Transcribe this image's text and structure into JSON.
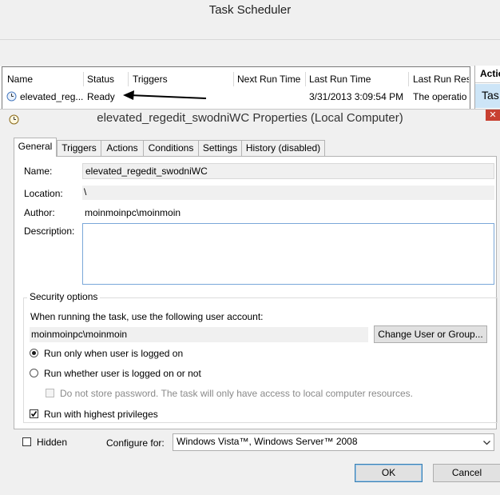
{
  "outer": {
    "title": "Task Scheduler",
    "columns": [
      "Name",
      "Status",
      "Triggers",
      "Next Run Time",
      "Last Run Time",
      "Last Run Resu"
    ],
    "row": {
      "name": "elevated_reg...",
      "status": "Ready",
      "triggers": "",
      "next_run": "",
      "last_run": "3/31/2013 3:09:54 PM",
      "last_result": "The operatio"
    },
    "actions_pane": {
      "header": "Actio",
      "item": "Tas"
    }
  },
  "dialog": {
    "title": "elevated_regedit_swodniWC Properties (Local Computer)",
    "close_glyph": "✕",
    "tabs": [
      "General",
      "Triggers",
      "Actions",
      "Conditions",
      "Settings",
      "History (disabled)"
    ],
    "general": {
      "name_label": "Name:",
      "name_value": "elevated_regedit_swodniWC",
      "location_label": "Location:",
      "location_value": "\\",
      "author_label": "Author:",
      "author_value": "moinmoinpc\\moinmoin",
      "description_label": "Description:",
      "description_value": ""
    },
    "security": {
      "title": "Security options",
      "account_prompt": "When running the task, use the following user account:",
      "account_value": "moinmoinpc\\moinmoin",
      "change_button": "Change User or Group...",
      "radio_logged_on": "Run only when user is logged on",
      "radio_logged_on_selected": true,
      "radio_whether": "Run whether user is logged on or not",
      "no_store_password": "Do not store password.  The task will only have access to local computer resources.",
      "highest_privileges": "Run with highest privileges",
      "highest_privileges_checked": true
    },
    "bottom": {
      "hidden_label": "Hidden",
      "hidden_checked": false,
      "configure_label": "Configure for:",
      "configure_value": "Windows Vista™, Windows Server™ 2008"
    },
    "buttons": {
      "ok": "OK",
      "cancel": "Cancel"
    }
  },
  "colors": {
    "annotation_arrow": "#000000",
    "close_button": "#c84031",
    "description_border": "#7aa7d9",
    "actions_selected": "#cde5f7"
  },
  "icons": [
    "clock-icon",
    "close-icon",
    "dropdown-arrow-icon",
    "checkmark-icon"
  ]
}
